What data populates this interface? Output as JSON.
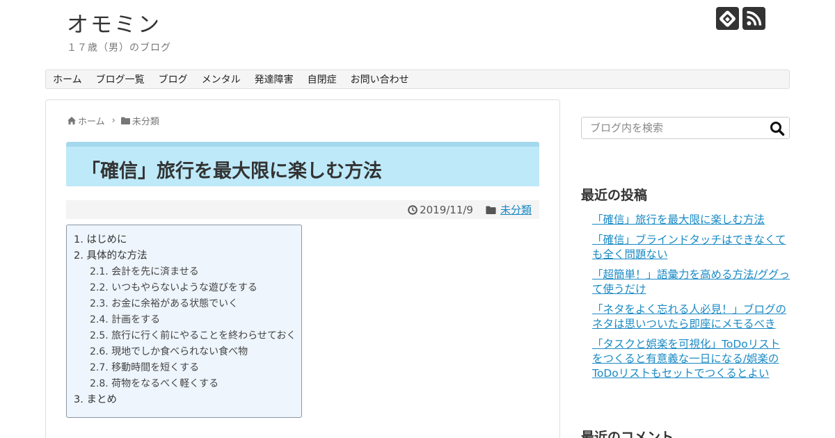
{
  "site": {
    "title": "オモミン",
    "description": "１７歳（男）のブログ"
  },
  "social": [
    {
      "name": "feedly-icon"
    },
    {
      "name": "rss-icon"
    }
  ],
  "nav": {
    "items": [
      {
        "label": "ホーム"
      },
      {
        "label": "ブログ一覧"
      },
      {
        "label": "ブログ"
      },
      {
        "label": "メンタル"
      },
      {
        "label": "発達障害"
      },
      {
        "label": "自閉症"
      },
      {
        "label": "お問い合わせ"
      }
    ]
  },
  "breadcrumb": {
    "home": "ホーム",
    "category": "未分類"
  },
  "post": {
    "title": "「確信」旅行を最大限に楽しむ方法",
    "date": "2019/11/9",
    "category": "未分類"
  },
  "toc": {
    "items": [
      {
        "label": "1. はじめに",
        "sub": false
      },
      {
        "label": "2. 具体的な方法",
        "sub": false
      },
      {
        "label": "2.1. 会計を先に済ませる",
        "sub": true
      },
      {
        "label": "2.2. いつもやらないような遊びをする",
        "sub": true
      },
      {
        "label": "2.3. お金に余裕がある状態でいく",
        "sub": true
      },
      {
        "label": "2.4. 計画をする",
        "sub": true
      },
      {
        "label": "2.5. 旅行に行く前にやることを終わらせておく",
        "sub": true
      },
      {
        "label": "2.6. 現地でしか食べられない食べ物",
        "sub": true
      },
      {
        "label": "2.7. 移動時間を短くする",
        "sub": true
      },
      {
        "label": "2.8. 荷物をなるべく軽くする",
        "sub": true
      },
      {
        "label": "3. まとめ",
        "sub": false
      }
    ]
  },
  "sidebar": {
    "search_placeholder": "ブログ内を検索",
    "recent_posts_title": "最近の投稿",
    "recent_posts": [
      {
        "label": "「確信」旅行を最大限に楽しむ方法"
      },
      {
        "label": "「確信」ブラインドタッチはできなくても全く問題ない"
      },
      {
        "label": "「超簡単！」語彙力を高める方法/ググって使うだけ"
      },
      {
        "label": "「ネタをよく忘れる人必見！」ブログのネタは思いついたら即座にメモるべき"
      },
      {
        "label": "「タスクと娯楽を可視化」ToDoリストをつくると有意義な一日になる/娯楽のToDoリストもセットでつくるとよい"
      }
    ],
    "recent_comments_title": "最近のコメント"
  },
  "colors": {
    "link": "#1a8ac4",
    "title_box": "#bde9f9",
    "toc_bg": "#eef5fc"
  }
}
